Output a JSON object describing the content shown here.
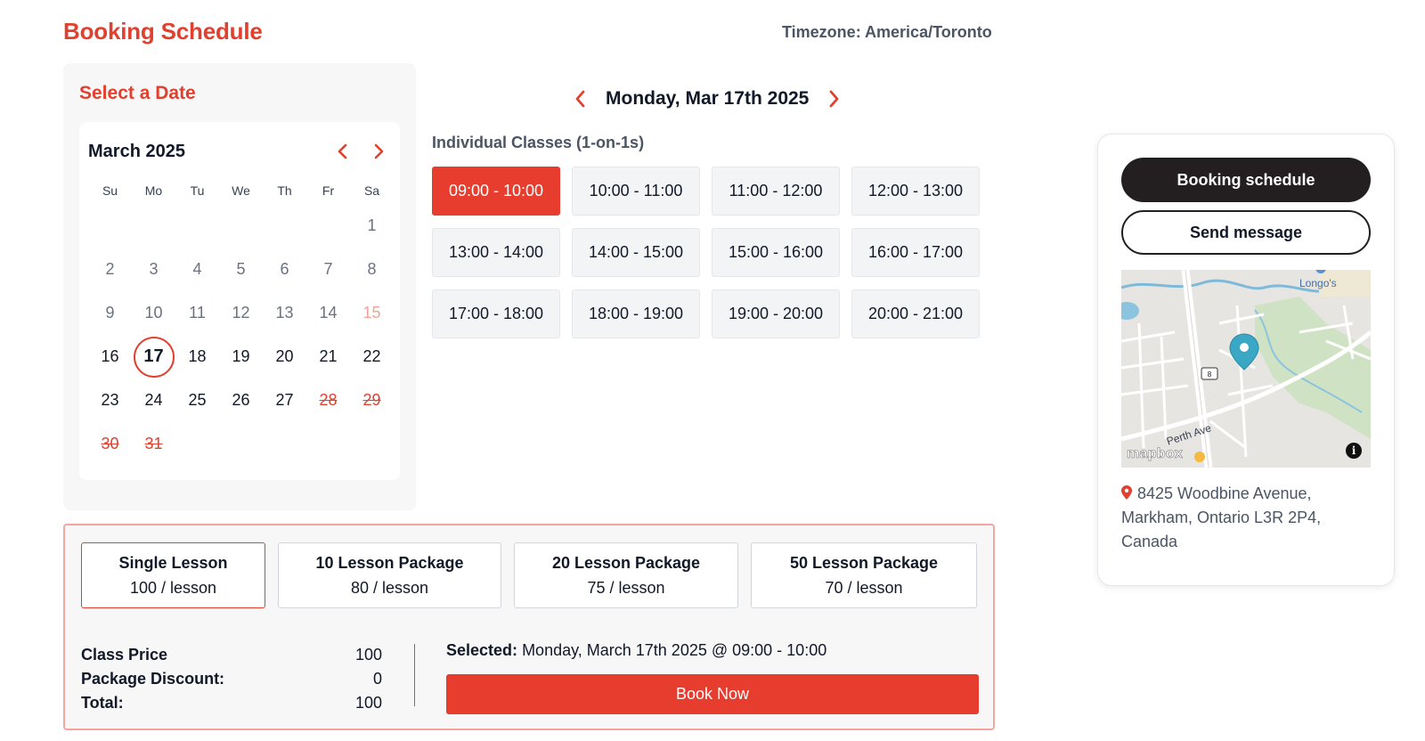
{
  "header": {
    "title": "Booking Schedule",
    "timezone_label": "Timezone:",
    "timezone_value": "America/Toronto"
  },
  "calendar": {
    "panel_title": "Select a Date",
    "month_label": "March 2025",
    "weekdays": [
      "Su",
      "Mo",
      "Tu",
      "We",
      "Th",
      "Fr",
      "Sa"
    ],
    "weeks": [
      [
        "",
        "",
        "",
        "",
        "",
        "",
        "1"
      ],
      [
        "2",
        "3",
        "4",
        "5",
        "6",
        "7",
        "8"
      ],
      [
        "9",
        "10",
        "11",
        "12",
        "13",
        "14",
        "15"
      ],
      [
        "16",
        "17",
        "18",
        "19",
        "20",
        "21",
        "22"
      ],
      [
        "23",
        "24",
        "25",
        "26",
        "27",
        "28",
        "29"
      ],
      [
        "30",
        "31",
        "",
        "",
        "",
        "",
        ""
      ]
    ],
    "selected_day": "17"
  },
  "day": {
    "label": "Monday, Mar 17th 2025"
  },
  "classes": {
    "title": "Individual Classes (1-on-1s)",
    "slots": [
      "09:00 - 10:00",
      "10:00 - 11:00",
      "11:00 - 12:00",
      "12:00 - 13:00",
      "13:00 - 14:00",
      "14:00 - 15:00",
      "15:00 - 16:00",
      "16:00 - 17:00",
      "17:00 - 18:00",
      "18:00 - 19:00",
      "19:00 - 20:00",
      "20:00 - 21:00"
    ],
    "active_slot": "09:00 - 10:00"
  },
  "packages": [
    {
      "name": "Single Lesson",
      "price": "100 / lesson"
    },
    {
      "name": "10 Lesson Package",
      "price": "80 / lesson"
    },
    {
      "name": "20 Lesson Package",
      "price": "75 / lesson"
    },
    {
      "name": "50 Lesson Package",
      "price": "70 / lesson"
    }
  ],
  "summary": {
    "class_price_label": "Class Price",
    "class_price_value": "100",
    "discount_label": "Package Discount:",
    "discount_value": "0",
    "total_label": "Total:",
    "total_value": "100",
    "selected_label": "Selected:",
    "selected_value": "Monday, March 17th 2025 @ 09:00 - 10:00",
    "book_label": "Book Now"
  },
  "sidebar": {
    "booking_button": "Booking schedule",
    "message_button": "Send message",
    "map_place_label": "Longo's",
    "map_road_label": "Perth Ave",
    "map_route_shield": "8",
    "map_attribution": "mapbox",
    "address": "8425 Woodbine Avenue, Markham, Ontario L3R 2P4, Canada"
  },
  "colors": {
    "accent": "#e2402f",
    "dark": "#231f20",
    "panel_bg": "#f7f7f8",
    "map_pin": "#3aa7c4"
  }
}
